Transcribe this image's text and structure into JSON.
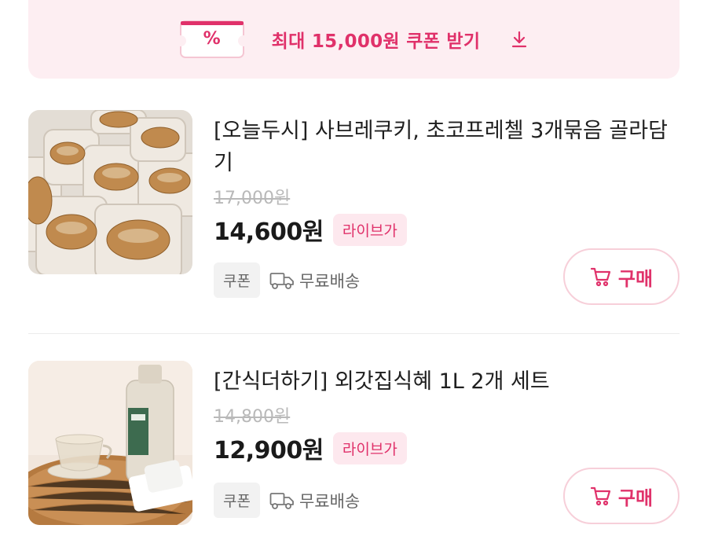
{
  "coupon_banner": {
    "ticket_symbol": "%",
    "text": "최대 15,000원 쿠폰 받기"
  },
  "products": [
    {
      "title": "[오늘두시] 사브레쿠키, 초코프레첼 3개묶음 골라담기",
      "original_price": "17,000원",
      "price": "14,600원",
      "badge": "라이브가",
      "coupon_tag": "쿠폰",
      "shipping": "무료배송",
      "buy_label": "구매"
    },
    {
      "title": "[간식더하기] 외갓집식혜 1L 2개 세트",
      "original_price": "14,800원",
      "price": "12,900원",
      "badge": "라이브가",
      "coupon_tag": "쿠폰",
      "shipping": "무료배송",
      "buy_label": "구매"
    }
  ],
  "colors": {
    "accent": "#e0316a",
    "banner_bg": "#fdeef2",
    "badge_bg": "#fde8ee",
    "button_border": "#f7cfd9"
  },
  "icons": [
    "coupon-ticket-icon",
    "download-icon",
    "truck-icon",
    "cart-icon"
  ]
}
